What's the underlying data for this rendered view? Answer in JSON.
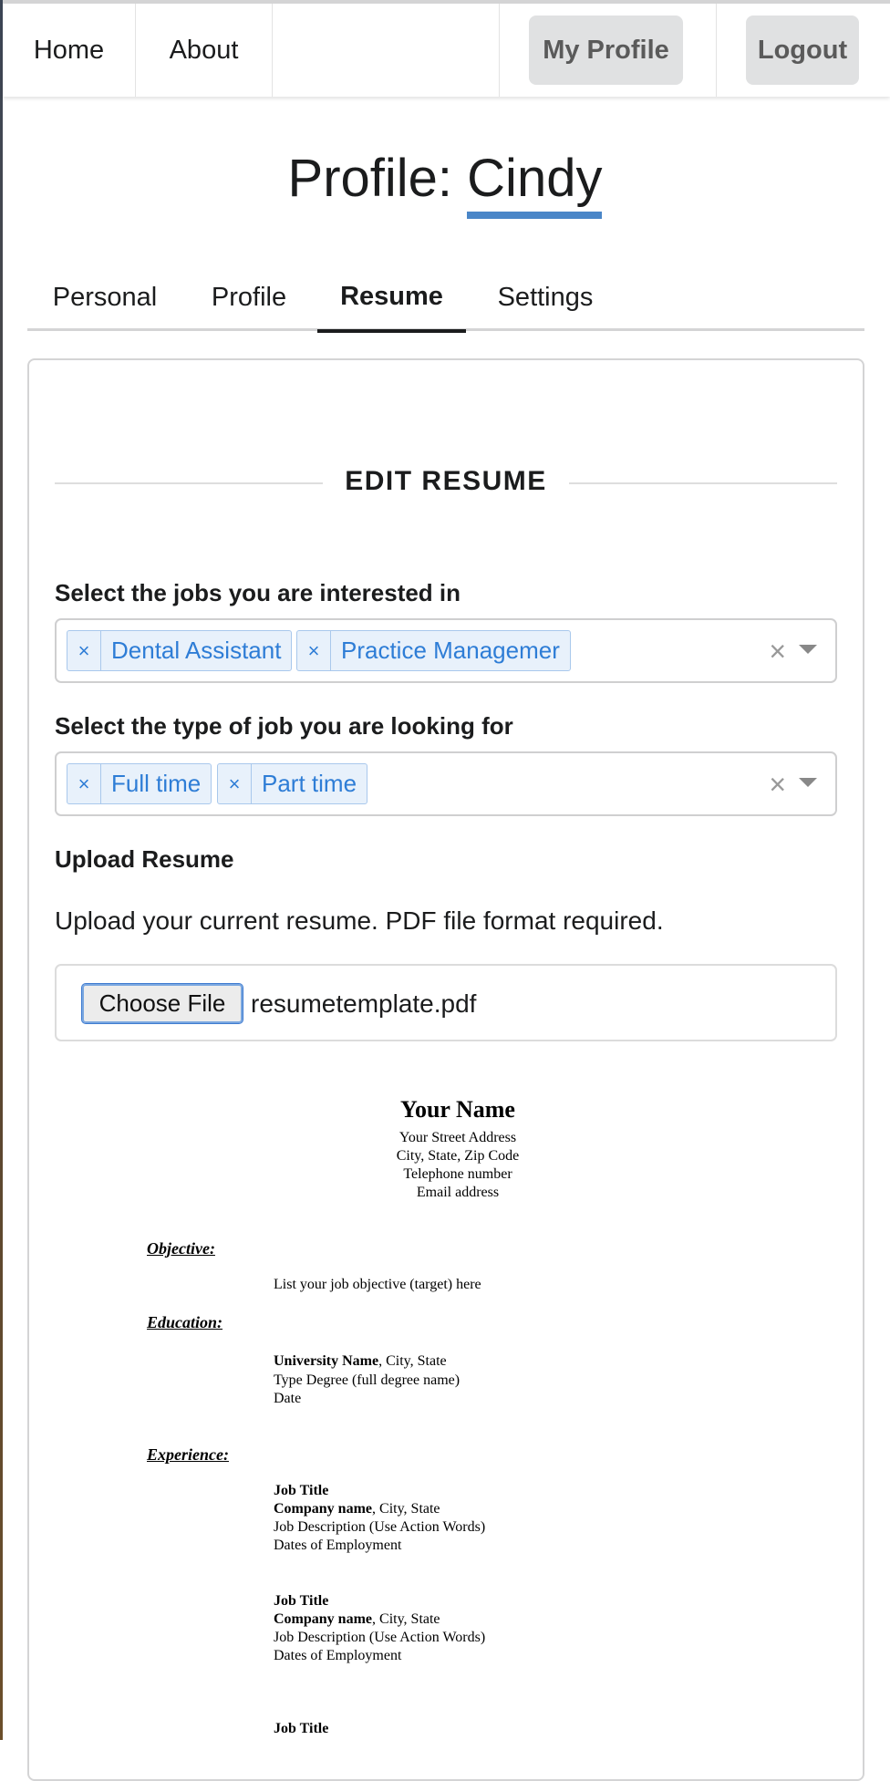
{
  "nav": {
    "home": "Home",
    "about": "About",
    "my_profile": "My Profile",
    "logout": "Logout"
  },
  "title": {
    "prefix": "Profile: ",
    "name": "Cindy"
  },
  "tabs": [
    "Personal",
    "Profile",
    "Resume",
    "Settings"
  ],
  "active_tab": "Resume",
  "section_header": "EDIT RESUME",
  "jobs": {
    "label": "Select the jobs you are interested in",
    "selected": [
      "Dental Assistant",
      "Practice Managemer"
    ]
  },
  "job_type": {
    "label": "Select the type of job you are looking for",
    "selected": [
      "Full time",
      "Part time"
    ]
  },
  "upload": {
    "label": "Upload Resume",
    "description": "Upload your current resume. PDF file format required.",
    "button": "Choose File",
    "file_name": "resumetemplate.pdf"
  },
  "icons": {
    "chip_remove": "×",
    "clear_all": "×"
  },
  "colors": {
    "accent": "#4a86c8",
    "chip_text": "#2e7dd6",
    "chip_bg": "#e8f1fb",
    "nav_button_bg": "#e0e1e2"
  },
  "resume_preview": {
    "name": "Your Name",
    "address": "Your Street Address",
    "city": "City, State, Zip Code",
    "phone": "Telephone number",
    "email": "Email address",
    "objective_heading": "Objective:",
    "objective_text": "List your job objective (target) here",
    "education_heading": "Education:",
    "university": "University Name",
    "university_location": ", City, State",
    "degree": "Type Degree (full degree name)",
    "edu_date": "Date",
    "experience_heading": "Experience:",
    "jobs": [
      {
        "title": "Job Title",
        "company": "Company name",
        "location": ", City, State",
        "description": "Job Description (Use Action Words)",
        "dates": "Dates of Employment"
      },
      {
        "title": "Job Title",
        "company": "Company name",
        "location": ", City, State",
        "description": "Job Description (Use Action Words)",
        "dates": "Dates of Employment"
      },
      {
        "title": "Job Title"
      }
    ]
  }
}
